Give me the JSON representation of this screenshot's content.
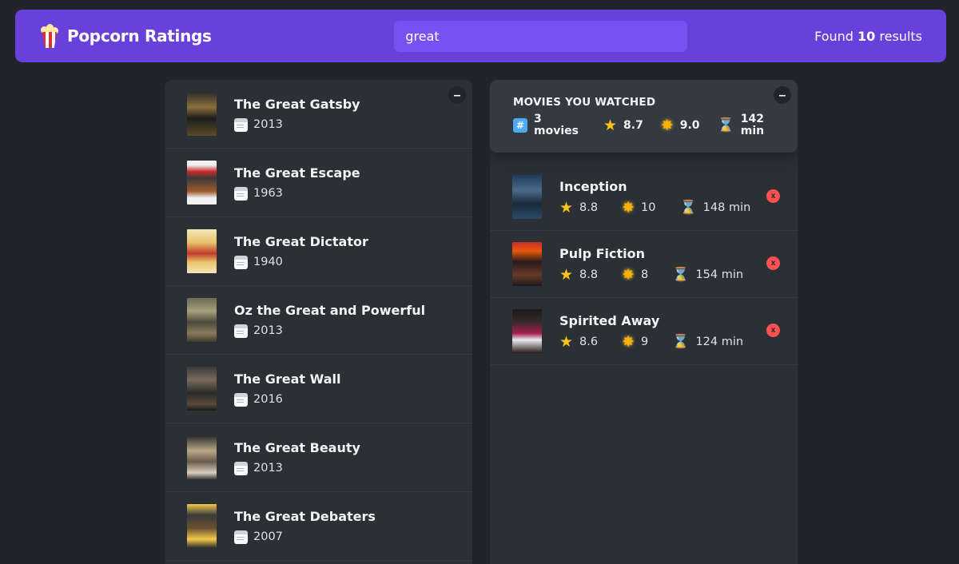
{
  "nav": {
    "logo_text": "Popcorn Ratings",
    "search_value": "great",
    "results_prefix": "Found ",
    "results_count": "10",
    "results_suffix": " results"
  },
  "search_list": {
    "toggle_label": "–",
    "movies": [
      {
        "title": "The Great Gatsby",
        "year": "2013"
      },
      {
        "title": "The Great Escape",
        "year": "1963"
      },
      {
        "title": "The Great Dictator",
        "year": "1940"
      },
      {
        "title": "Oz the Great and Powerful",
        "year": "2013"
      },
      {
        "title": "The Great Wall",
        "year": "2016"
      },
      {
        "title": "The Great Beauty",
        "year": "2013"
      },
      {
        "title": "The Great Debaters",
        "year": "2007"
      }
    ]
  },
  "watched": {
    "toggle_label": "–",
    "summary": {
      "title": "Movies you watched",
      "count_line1": "3",
      "count_line2": "movies",
      "imdb_avg": "8.7",
      "user_avg": "9.0",
      "runtime_line1": "142",
      "runtime_line2": "min"
    },
    "movies": [
      {
        "title": "Inception",
        "imdb": "8.8",
        "user": "10",
        "runtime": "148 min"
      },
      {
        "title": "Pulp Fiction",
        "imdb": "8.8",
        "user": "8",
        "runtime": "154 min"
      },
      {
        "title": "Spirited Away",
        "imdb": "8.6",
        "user": "9",
        "runtime": "124 min"
      }
    ],
    "delete_label": "x"
  },
  "icons": {
    "logo": "popcorn-icon",
    "year": "calendar-icon",
    "count": "hash-icon",
    "imdb": "star-icon",
    "user": "glowing-star-icon",
    "runtime": "hourglass-icon"
  },
  "colors": {
    "accent": "#6741d9",
    "search_bg": "#7950f2",
    "background": "#212529",
    "panel": "#2b3035",
    "summary": "#343a40",
    "delete": "#fa5252"
  }
}
